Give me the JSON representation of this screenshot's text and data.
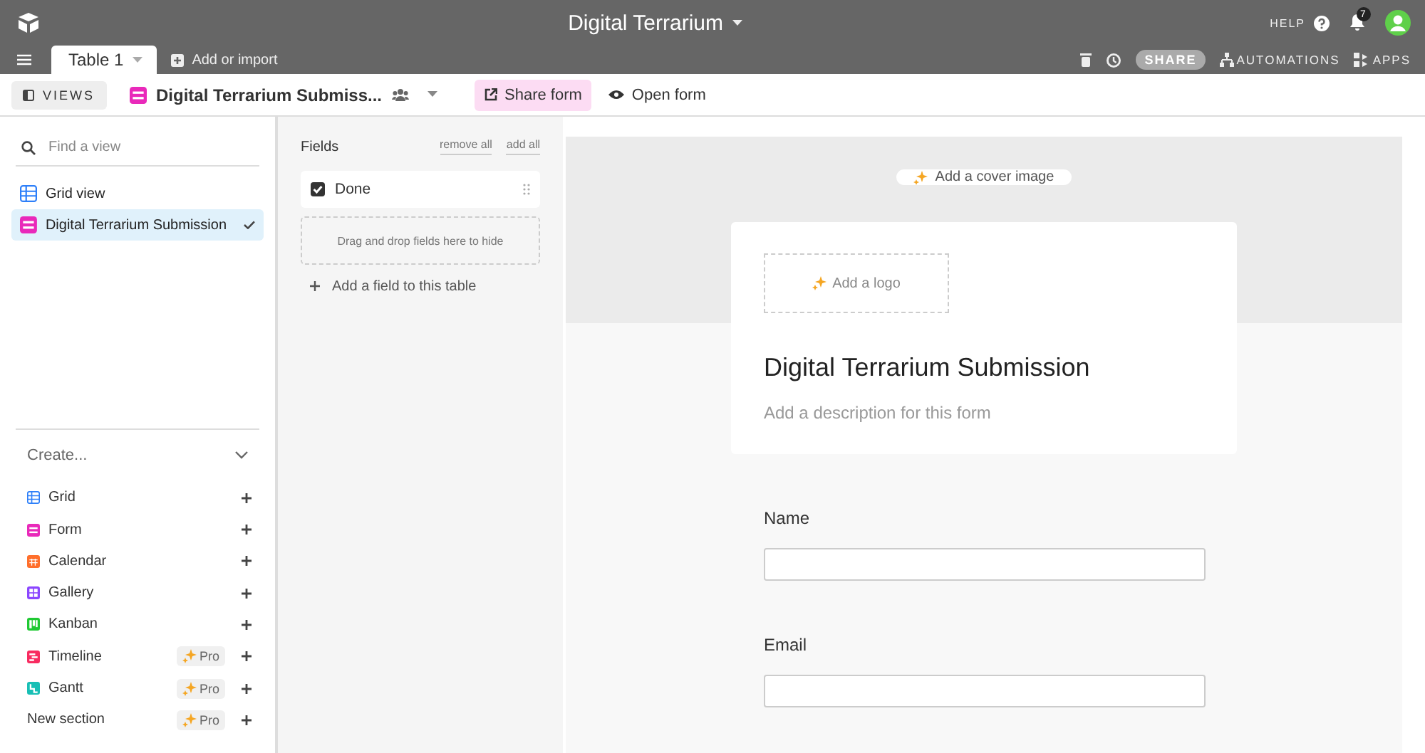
{
  "app_bar": {
    "title": "Digital Terrarium",
    "help": "HELP",
    "notification_count": "7"
  },
  "table_tabs": [
    {
      "label": "Table 1",
      "selected": true
    }
  ],
  "add_import": "Add or import",
  "actions": {
    "share": "SHARE",
    "automations": "AUTOMATIONS",
    "apps": "APPS"
  },
  "toolbar": {
    "views_button": "VIEWS",
    "view_name": "Digital Terrarium Submiss...",
    "share_form": "Share form",
    "open_form": "Open form"
  },
  "sidebar": {
    "search": {
      "placeholder": "Find a view"
    },
    "views": [
      {
        "name": "Grid view",
        "kind": "grid",
        "selected": false
      },
      {
        "name": "Digital Terrarium Submission",
        "kind": "form",
        "selected": true
      }
    ],
    "create": {
      "title": "Create...",
      "items": [
        {
          "label": "Grid",
          "kind": "grid",
          "color": "#2d7ff9"
        },
        {
          "label": "Form",
          "kind": "form",
          "color": "#e929ba"
        },
        {
          "label": "Calendar",
          "kind": "calendar",
          "color": "#ff6f2c"
        },
        {
          "label": "Gallery",
          "kind": "gallery",
          "color": "#8b46ff"
        },
        {
          "label": "Kanban",
          "kind": "kanban",
          "color": "#20c933"
        },
        {
          "label": "Timeline",
          "kind": "timeline",
          "color": "#f82b60",
          "pro": "Pro"
        },
        {
          "label": "Gantt",
          "kind": "gantt",
          "color": "#18bfb5",
          "pro": "Pro"
        },
        {
          "label": "New section",
          "kind": "section",
          "pro": "Pro"
        }
      ]
    }
  },
  "fields_panel": {
    "title": "Fields",
    "remove_all": "remove all",
    "add_all": "add all",
    "fields": [
      {
        "name": "Done"
      }
    ],
    "drop_hint": "Drag and drop fields here to hide",
    "add_field": "Add a field to this table"
  },
  "form": {
    "cover_button": "Add a cover image",
    "logo_button": "Add a logo",
    "title": "Digital Terrarium Submission",
    "description": "Add a description for this form",
    "questions": [
      {
        "label": "Name"
      },
      {
        "label": "Email"
      }
    ]
  }
}
